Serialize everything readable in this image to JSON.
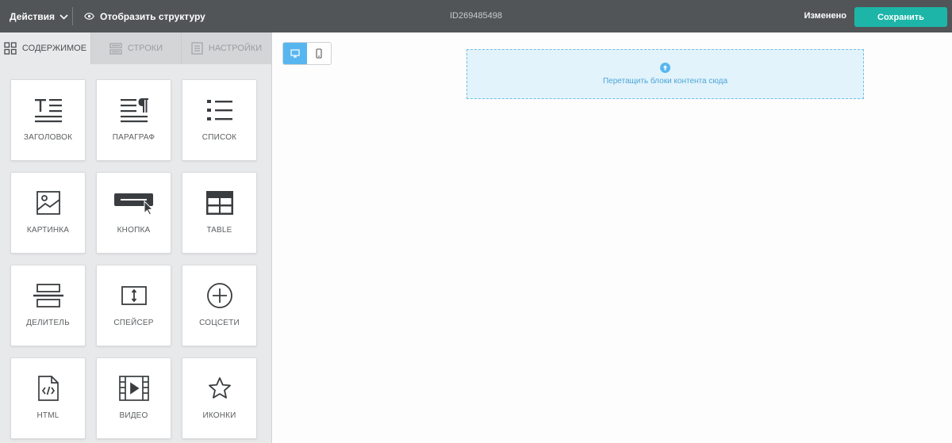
{
  "topbar": {
    "actions_label": "Действия",
    "structure_label": "Отобразить структуру",
    "document_id": "ID269485498",
    "status": "Изменено",
    "save_label": "Сохранить",
    "save_color": "#1eb5a9",
    "background_color": "#515558"
  },
  "sidebar": {
    "tabs": [
      {
        "label": "СОДЕРЖИМОЕ",
        "icon": "grid-icon",
        "active": true
      },
      {
        "label": "СТРОКИ",
        "icon": "rows-icon",
        "active": false
      },
      {
        "label": "НАСТРОЙКИ",
        "icon": "settings-page-icon",
        "active": false
      }
    ],
    "blocks": [
      {
        "label": "ЗАГОЛОВОК",
        "icon": "heading-icon"
      },
      {
        "label": "ПАРАГРАФ",
        "icon": "paragraph-icon"
      },
      {
        "label": "СПИСОК",
        "icon": "list-icon"
      },
      {
        "label": "КАРТИНКА",
        "icon": "image-icon"
      },
      {
        "label": "КНОПКА",
        "icon": "button-icon"
      },
      {
        "label": "TABLE",
        "icon": "table-icon"
      },
      {
        "label": "ДЕЛИТЕЛЬ",
        "icon": "divider-icon"
      },
      {
        "label": "СПЕЙСЕР",
        "icon": "spacer-icon"
      },
      {
        "label": "СОЦСЕТИ",
        "icon": "social-plus-icon"
      },
      {
        "label": "HTML",
        "icon": "html-file-icon"
      },
      {
        "label": "ВИДЕО",
        "icon": "video-icon"
      },
      {
        "label": "ИКОНКИ",
        "icon": "star-icon"
      }
    ]
  },
  "canvas": {
    "device_modes": [
      {
        "name": "desktop",
        "icon": "desktop-icon",
        "active": true
      },
      {
        "name": "mobile",
        "icon": "mobile-icon",
        "active": false
      }
    ],
    "dropzone_text": "Перетащить блоки контента сюда",
    "accent_color": "#57b6ef"
  }
}
